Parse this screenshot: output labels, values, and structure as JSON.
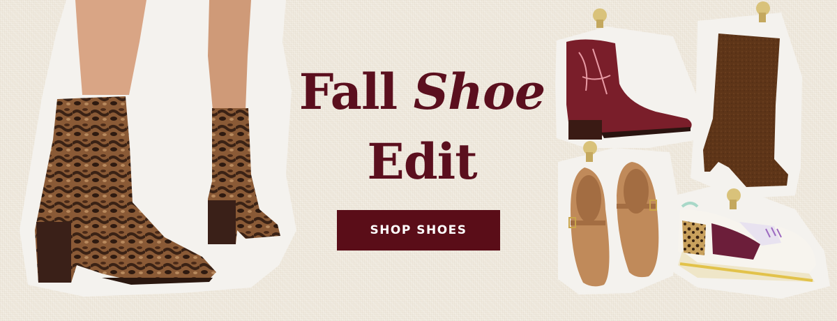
{
  "banner": {
    "headline": {
      "word1": "Fall",
      "word2": "Shoe",
      "word3": "Edit"
    },
    "cta_label": "SHOP SHOES"
  },
  "colors": {
    "brand": "#5a0d18",
    "background": "#f0eadf",
    "paper_cutout": "#f4f2ee",
    "snakeskin_brown": "#7a4a2a",
    "burgundy_boot": "#7a1e2a",
    "suede_brown": "#5c3418",
    "tan_flat": "#c08a5a",
    "pushpin": "#d9c27a"
  },
  "products": [
    {
      "name": "snakeskin-ankle-boots-icon"
    },
    {
      "name": "burgundy-western-boot-icon"
    },
    {
      "name": "brown-suede-tall-boot-icon"
    },
    {
      "name": "tan-mary-jane-flats-icon"
    },
    {
      "name": "retro-sneaker-icon"
    }
  ]
}
